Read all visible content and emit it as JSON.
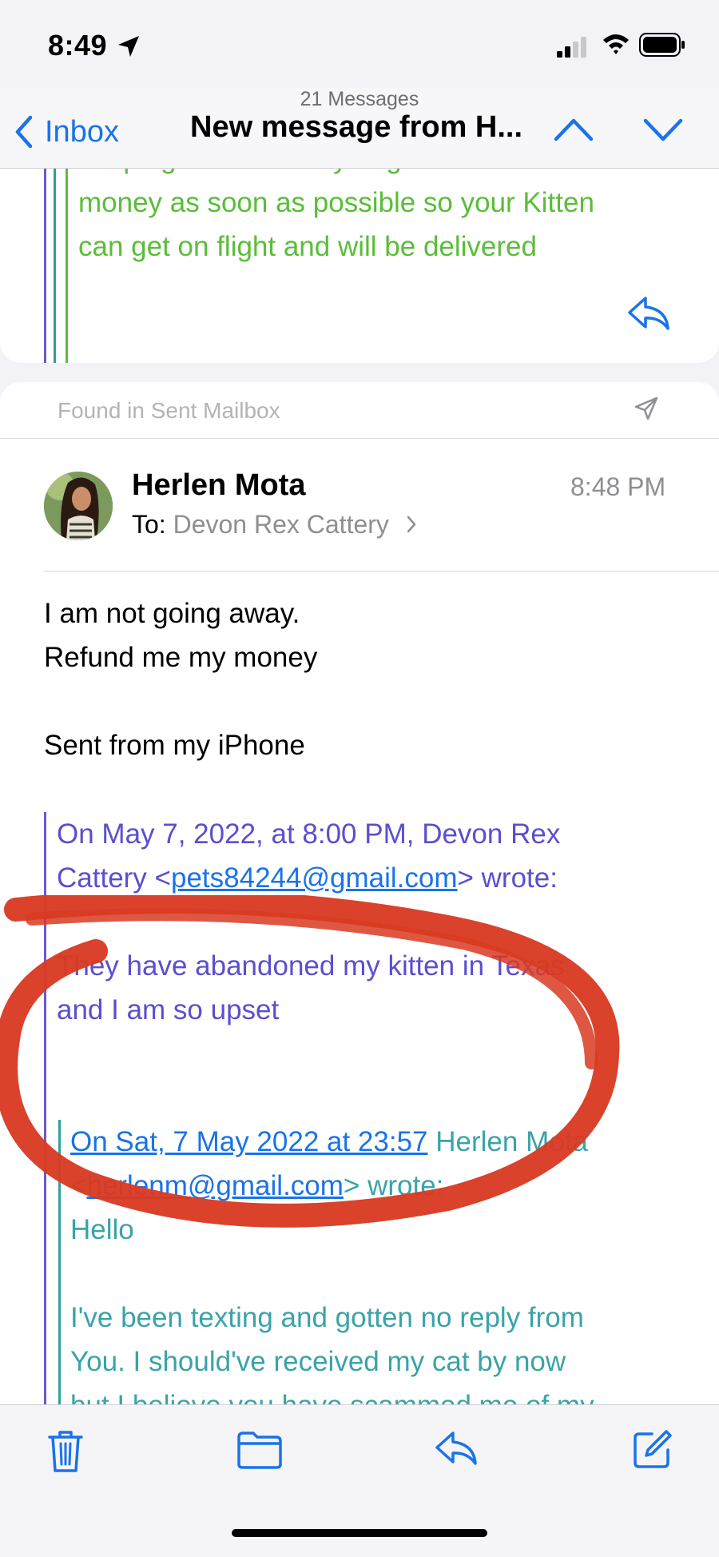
{
  "status": {
    "time": "8:49"
  },
  "nav": {
    "back_label": "Inbox",
    "message_count": "21 Messages",
    "title": "New message from H..."
  },
  "previous_message": {
    "quoted_text": "keeping the crate. Try to give them the\nmoney as soon as possible so your Kitten\ncan get on flight and will be delivered"
  },
  "message": {
    "found_in": "Found in Sent Mailbox",
    "sender": "Herlen Mota",
    "time": "8:48 PM",
    "to_label": "To:",
    "recipient": "Devon Rex Cattery",
    "body": {
      "line1": "I am not going away.",
      "line2": "Refund me my money",
      "signature": "Sent from my iPhone"
    },
    "quote1": {
      "header_start": "On May 7, 2022, at 8:00 PM, Devon Rex",
      "header_prefix": "Cattery <",
      "header_email": "pets84244@gmail.com",
      "header_suffix": "> wrote:",
      "line1": "They have abandoned my kitten in Texas",
      "line2": "and I am so upset"
    },
    "quote2": {
      "header_link": "On Sat, 7 May 2022 at 23:57",
      "header_name": " Herlen Mota",
      "header_prefix": "<",
      "header_email": "herlenm@gmail.com",
      "header_suffix": "> wrote:",
      "line1": "Hello",
      "line2": "I've been texting and gotten no reply from",
      "line3": "You. I should've received my cat by now",
      "line4": "but I believe you have scammed me of my"
    }
  },
  "colors": {
    "accent": "#1a73e8",
    "quote_purple": "#5a4fcf",
    "quote_teal": "#3aa3a8",
    "quote_green": "#5bbd3a",
    "scribble": "#d93a22"
  }
}
